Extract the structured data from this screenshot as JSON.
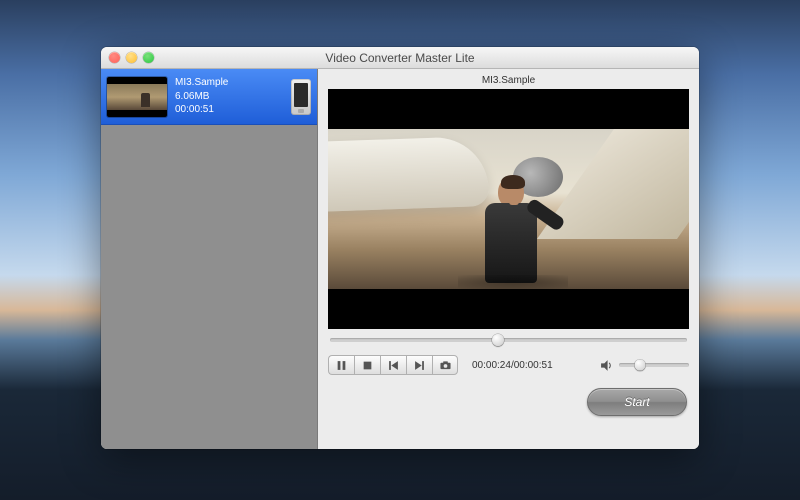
{
  "window": {
    "title": "Video Converter Master Lite"
  },
  "sidebar": {
    "items": [
      {
        "name": "MI3.Sample",
        "size": "6.06MB",
        "duration": "00:00:51"
      }
    ]
  },
  "preview": {
    "title": "MI3.Sample",
    "scrub_progress": 0.47,
    "time_current": "00:00:24",
    "time_total": "00:00:51",
    "volume": 0.3
  },
  "controls": {
    "pause": "pause",
    "stop": "stop",
    "prev": "previous",
    "next": "next",
    "snapshot": "snapshot"
  },
  "footer": {
    "start_label": "Start"
  }
}
